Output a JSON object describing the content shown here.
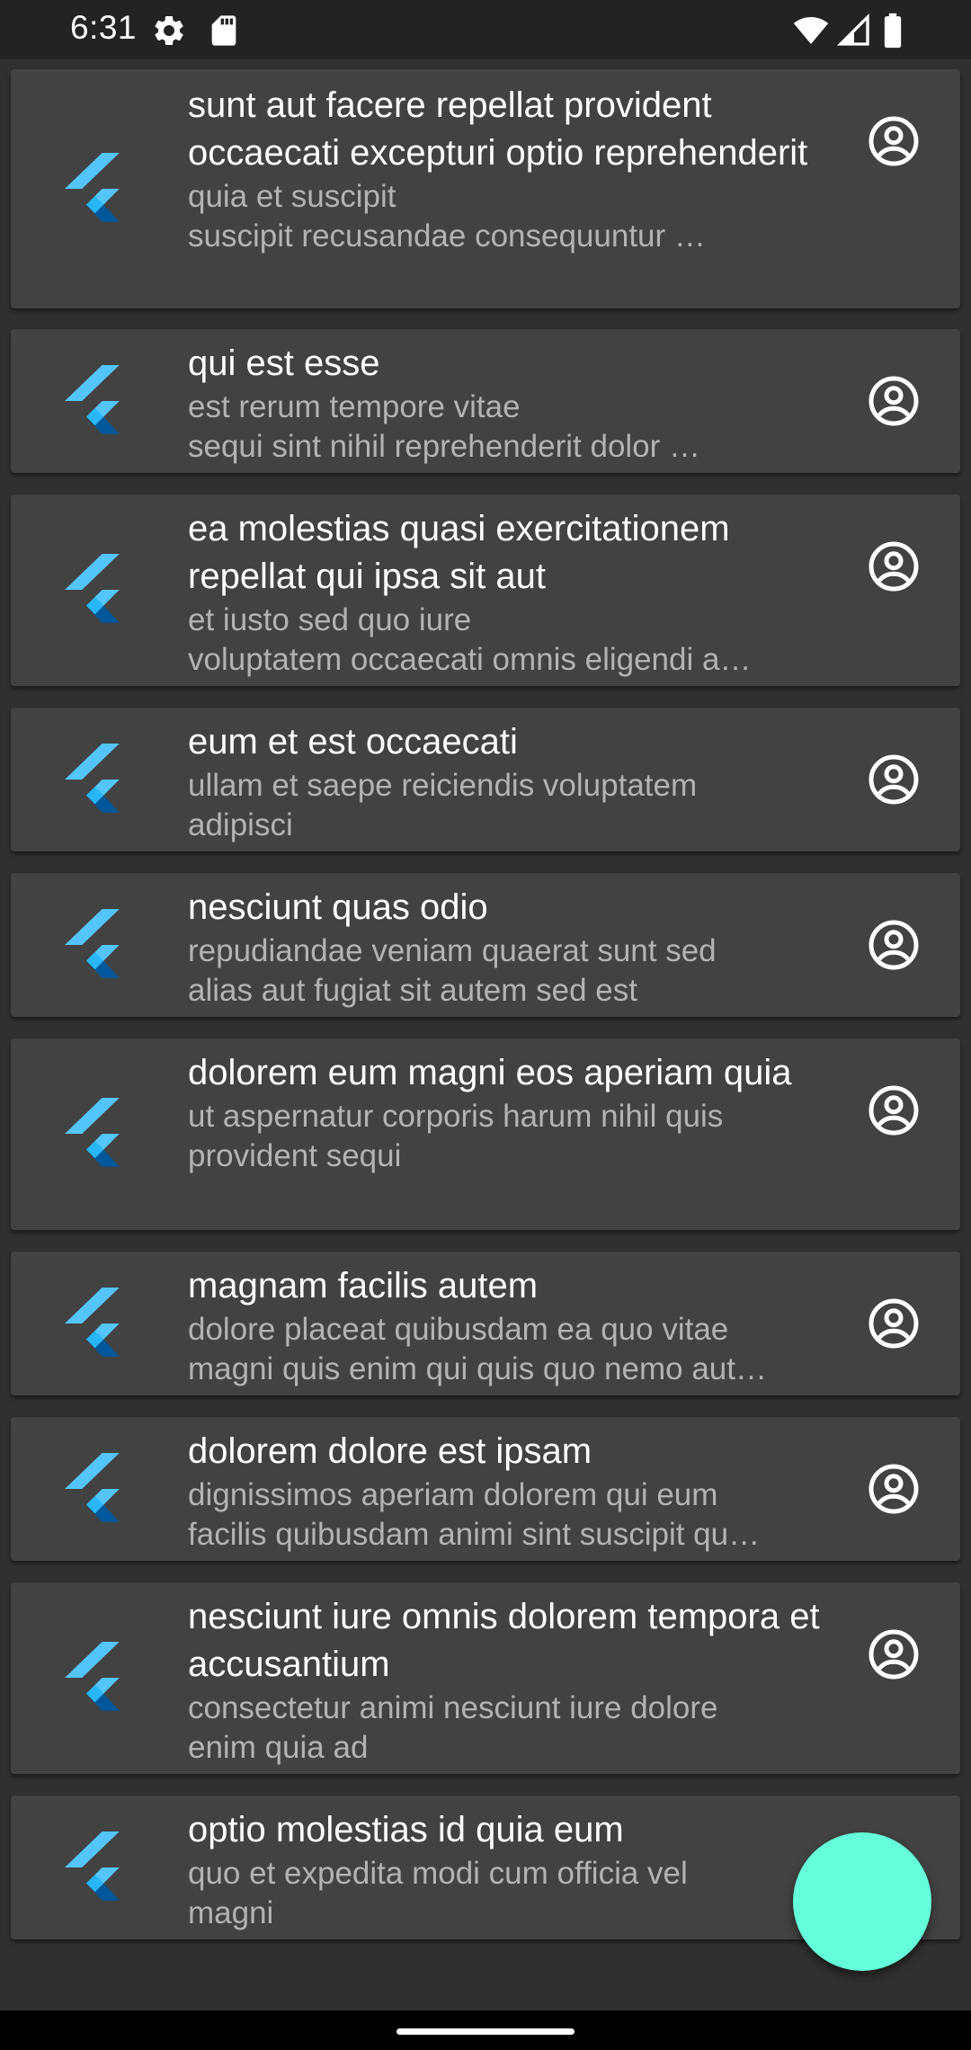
{
  "status_bar": {
    "time": "6:31",
    "icons": [
      "gear-icon",
      "sd-card-icon",
      "wifi-icon",
      "signal-icon",
      "battery-icon"
    ]
  },
  "posts": [
    {
      "title": "sunt aut facere repellat provident occaecati excepturi optio reprehenderit",
      "body": "quia et suscipit\nsuscipit recusandae consequuntur …"
    },
    {
      "title": "qui est esse",
      "body": "est rerum tempore vitae\nsequi sint nihil reprehenderit dolor …"
    },
    {
      "title": "ea molestias quasi exercitationem repellat qui ipsa sit aut",
      "body": "et iusto sed quo iure\nvoluptatem occaecati omnis eligendi a…"
    },
    {
      "title": "eum et est occaecati",
      "body": "ullam et saepe reiciendis voluptatem\nadipisci"
    },
    {
      "title": "nesciunt quas odio",
      "body": "repudiandae veniam quaerat sunt sed\nalias aut fugiat sit autem sed est"
    },
    {
      "title": "dolorem eum magni eos aperiam quia",
      "body": "ut aspernatur corporis harum nihil quis\nprovident sequi"
    },
    {
      "title": "magnam facilis autem",
      "body": "dolore placeat quibusdam ea quo vitae\nmagni quis enim qui quis quo nemo aut…"
    },
    {
      "title": "dolorem dolore est ipsam",
      "body": "dignissimos aperiam dolorem qui eum\nfacilis quibusdam animi sint suscipit qu…"
    },
    {
      "title": "nesciunt iure omnis dolorem tempora et accusantium",
      "body": "consectetur animi nesciunt iure dolore\nenim quia ad"
    },
    {
      "title": "optio molestias id quia eum",
      "body": "quo et expedita modi cum officia vel\nmagni"
    }
  ],
  "icons": {
    "leading": "flutter-logo-icon",
    "trailing": "account-circle-icon",
    "fab": "floating-action-button"
  },
  "colors": {
    "background": "#303030",
    "card": "#424242",
    "status_bar": "#232323",
    "title_text": "#ffffff",
    "subtitle_text": "#b3b3b3",
    "fab": "#64ffda",
    "flutter_light": "#54c5f8",
    "flutter_dark": "#01579b"
  }
}
